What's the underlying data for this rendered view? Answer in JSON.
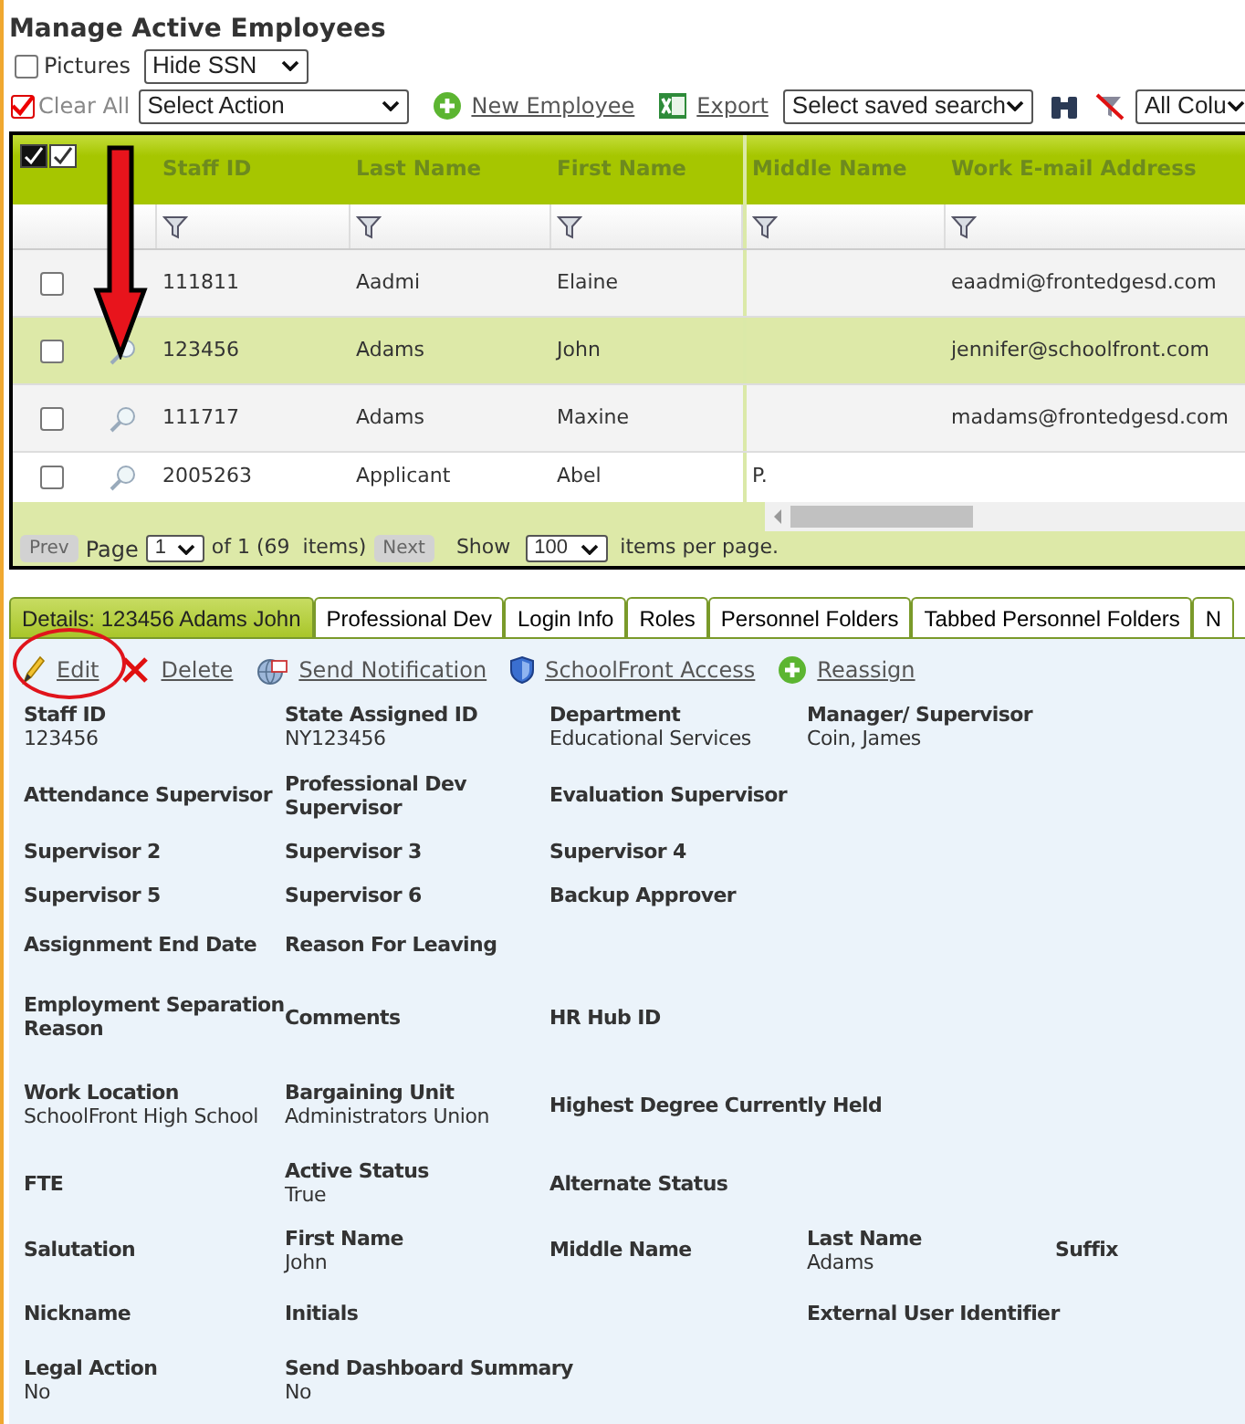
{
  "title": "Manage Active Employees",
  "pictures": {
    "label": "Pictures",
    "checked": false
  },
  "ssn_select": "Hide SSN",
  "clear_all": {
    "label": "Clear All",
    "checked": true
  },
  "action_select": "Select Action",
  "links": [
    {
      "kind": "add",
      "label": "New Employee"
    },
    {
      "kind": "excel",
      "label": "Export"
    }
  ],
  "saved_search": "Select saved search",
  "columns_select": "All Colu",
  "grid": {
    "columns": [
      "Staff ID",
      "Last Name",
      "First Name",
      "Middle Name",
      "Work E-mail Address"
    ],
    "rows": [
      {
        "selected": false,
        "checked": false,
        "view": false,
        "staff_id": "111811",
        "last_name": "Aadmi",
        "first_name": "Elaine",
        "email": "eaadmi@frontedgesd.com"
      },
      {
        "selected": true,
        "checked": false,
        "view": true,
        "staff_id": "123456",
        "last_name": "Adams",
        "first_name": "John",
        "email": "jennifer@schoolfront.com"
      },
      {
        "selected": false,
        "checked": false,
        "view": true,
        "staff_id": "111717",
        "last_name": "Adams",
        "first_name": "Maxine",
        "email": "madams@frontedgesd.com"
      },
      {
        "selected": false,
        "checked": false,
        "view": true,
        "staff_id": "2005263",
        "last_name": "Applicant",
        "first_name": "Abel",
        "middle_name": "P."
      }
    ]
  },
  "pager": {
    "prev": {
      "label": "Prev",
      "disabled": true
    },
    "page_label": "Page",
    "page": "1",
    "of": "of 1",
    "count": "(69  items)",
    "next": {
      "label": "Next",
      "disabled": true
    },
    "show": "Show",
    "per_page": "100",
    "suffix": "items per page."
  },
  "tabs": [
    {
      "label": "Details: 123456 Adams John",
      "selected": true
    },
    {
      "label": "Professional Dev",
      "selected": false
    },
    {
      "label": "Login Info",
      "selected": false
    },
    {
      "label": "Roles",
      "selected": false
    },
    {
      "label": "Personnel Folders",
      "selected": false
    },
    {
      "label": "Tabbed Personnel Folders",
      "selected": false
    },
    {
      "label": "N",
      "selected": false
    }
  ],
  "actions": [
    {
      "kind": "edit",
      "label": "Edit"
    },
    {
      "kind": "delete",
      "label": "Delete"
    },
    {
      "kind": "notify",
      "label": "Send Notification"
    },
    {
      "kind": "shield",
      "label": "SchoolFront Access"
    },
    {
      "kind": "add",
      "label": "Reassign"
    }
  ],
  "detail_rows": [
    [
      {
        "label": "Staff ID",
        "value": "123456"
      },
      {
        "label": "State Assigned ID",
        "value": "NY123456"
      },
      {
        "label": "Department",
        "value": "Educational Services"
      },
      {
        "label": "Manager/ Supervisor",
        "value": "Coin, James"
      }
    ],
    [
      {
        "label": "Attendance Supervisor"
      },
      {
        "label": "Professional Dev Supervisor"
      },
      {
        "label": "Evaluation Supervisor"
      }
    ],
    [
      {
        "label": "Supervisor 2"
      },
      {
        "label": "Supervisor 3"
      },
      {
        "label": "Supervisor 4"
      }
    ],
    [
      {
        "label": "Supervisor 5"
      },
      {
        "label": "Supervisor 6"
      },
      {
        "label": "Backup Approver"
      }
    ],
    [
      {
        "label": "Assignment End Date"
      },
      {
        "label": "Reason For Leaving"
      }
    ],
    [
      {
        "label": "Employment Separation Reason"
      },
      {
        "label": "Comments"
      },
      {
        "label": "HR Hub ID"
      }
    ],
    [
      {
        "label": "Work Location",
        "value": "SchoolFront High School"
      },
      {
        "label": "Bargaining Unit",
        "value": "Administrators Union"
      },
      {
        "label": "Highest Degree Currently Held"
      }
    ],
    [
      {
        "label": "FTE"
      },
      {
        "label": "Active Status",
        "value": "True"
      },
      {
        "label": "Alternate Status"
      }
    ],
    [
      {
        "label": "Salutation"
      },
      {
        "label": "First Name",
        "value": "John"
      },
      {
        "label": "Middle Name"
      },
      {
        "label": "Last Name",
        "value": "Adams"
      },
      {
        "label": "Suffix"
      }
    ],
    [
      {
        "label": "Nickname"
      },
      {
        "label": "Initials"
      },
      null,
      {
        "label": "External User Identifier"
      }
    ],
    [
      {
        "label": "Legal Action",
        "value": "No"
      },
      {
        "label": "Send Dashboard Summary",
        "value": "No"
      }
    ]
  ]
}
